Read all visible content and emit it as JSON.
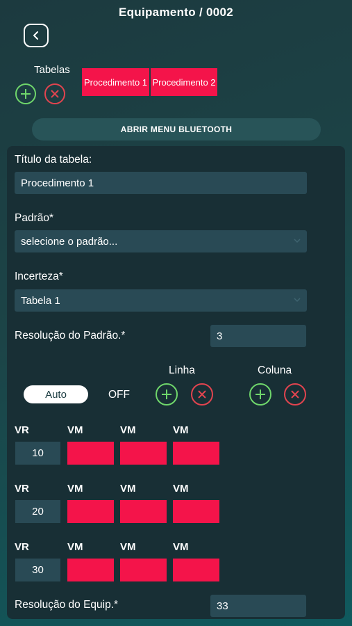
{
  "header": {
    "title": "Equipamento / 0002"
  },
  "tables": {
    "label": "Tabelas",
    "tabs": [
      "Procedimento 1",
      "Procedimento 2"
    ]
  },
  "bluetooth_button": "ABRIR MENU BLUETOOTH",
  "form": {
    "table_title_label": "Título da tabela:",
    "table_title_value": "Procedimento 1",
    "standard_label": "Padrão*",
    "standard_value": "selecione o padrão...",
    "uncertainty_label": "Incerteza*",
    "uncertainty_value": "Tabela 1",
    "standard_resolution_label": "Resolução do Padrão.*",
    "standard_resolution_value": "3",
    "equip_resolution_label": "Resolução do Equip.*",
    "equip_resolution_value": "33"
  },
  "controls": {
    "auto_label": "Auto",
    "off_label": "OFF",
    "row_label": "Linha",
    "column_label": "Coluna"
  },
  "grid": {
    "vr_header": "VR",
    "vm_header": "VM",
    "rows": [
      {
        "vr": "10"
      },
      {
        "vr": "20"
      },
      {
        "vr": "30"
      }
    ]
  },
  "colors": {
    "accent_red": "#f4144a",
    "add_green": "#6fd66b",
    "remove_red": "#e2444f"
  }
}
